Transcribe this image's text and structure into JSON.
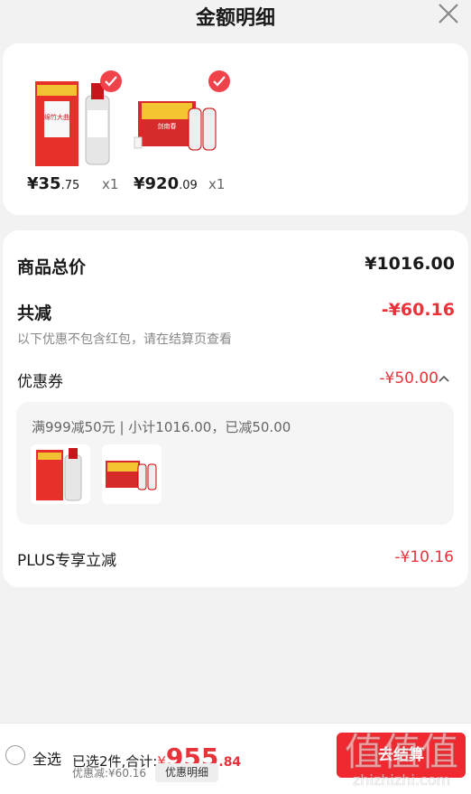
{
  "header": {
    "title": "金额明细"
  },
  "products": [
    {
      "price_main": "¥35",
      "price_cents": ".75",
      "qty": "x1"
    },
    {
      "price_main": "¥920",
      "price_cents": ".09",
      "qty": "x1"
    }
  ],
  "product_img_labels": [
    "绵竹大曲",
    "剑南春"
  ],
  "summary": {
    "total_label": "商品总价",
    "total_value": "¥1016.00",
    "reduce_label": "共减",
    "reduce_value": "-¥60.16",
    "note": "以下优惠不包含红包，请在结算页查看",
    "coupon_label": "优惠券",
    "coupon_value": "-¥50.00",
    "coupon_detail": "满999减50元 | 小计1016.00，已减50.00",
    "plus_label": "PLUS专享立减",
    "plus_value": "-¥10.16"
  },
  "bottom": {
    "select_all": "全选",
    "selected_text": "已选2件,合计:",
    "yen": "¥",
    "amount_main": "955",
    "amount_cents": ".84",
    "discount_text": "优惠减:¥60.16",
    "detail_button": "优惠明细",
    "checkout_button": "去结算"
  },
  "watermark": {
    "brand": "值得买",
    "url": "zhizhizhi.com"
  },
  "colors": {
    "accent": "#e8333a",
    "check": "#f0424a"
  }
}
